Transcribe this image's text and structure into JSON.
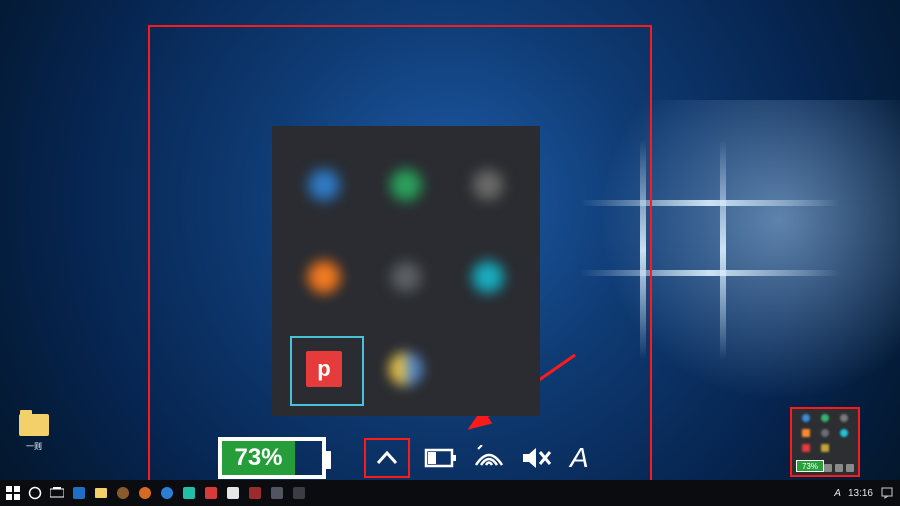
{
  "desktop": {
    "folder_label": "一则"
  },
  "battery": {
    "percent_text": "73%",
    "percent_fill": 73
  },
  "tray_panel": {
    "selected_app_letter": "p"
  },
  "taskbar": {
    "ime_text": "A",
    "clock": "13:16"
  },
  "mini_battery": "73%",
  "colors": {
    "annotation": "#ff1a1a",
    "battery_fill": "#259e3a",
    "selection": "#49c2d9",
    "p_icon": "#e63b3b",
    "panel_bg": "#2a2c31"
  }
}
